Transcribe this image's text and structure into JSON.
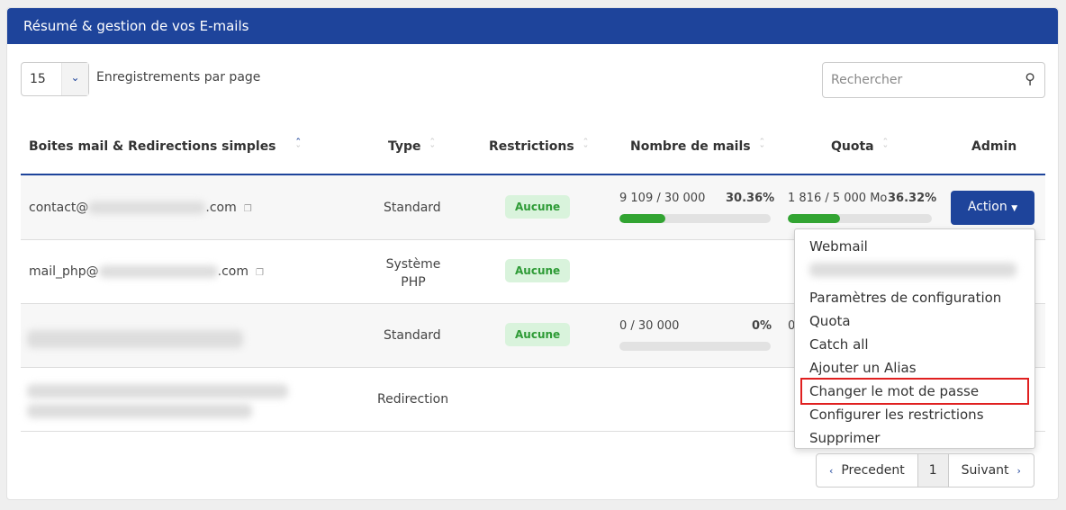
{
  "header": {
    "title": "Résumé & gestion de vos E-mails"
  },
  "controls": {
    "per_page_value": "15",
    "per_page_label": "Enregistrements par page",
    "search_placeholder": "Rechercher"
  },
  "columns": [
    "Boites mail & Redirections simples",
    "Type",
    "Restrictions",
    "Nombre de mails",
    "Quota",
    "Admin"
  ],
  "rows": [
    {
      "email_prefix": "contact@",
      "email_suffix": ".com",
      "type": "Standard",
      "restriction": "Aucune",
      "mails": "9 109 / 30 000",
      "mails_pct": "30.36%",
      "mails_fill": 30.36,
      "quota": "1 816 / 5 000 Mo",
      "quota_pct": "36.32%",
      "quota_fill": 36.32,
      "action": "Action"
    },
    {
      "email_prefix": "mail_php@",
      "email_suffix": ".com",
      "type": "Système PHP",
      "restriction": "Aucune"
    },
    {
      "type": "Standard",
      "restriction": "Aucune",
      "mails": "0 / 30 000",
      "mails_pct": "0%",
      "mails_fill": 0,
      "quota": "0"
    },
    {
      "type": "Redirection"
    }
  ],
  "menu": [
    "Webmail",
    "Paramètres de configuration",
    "Quota",
    "Catch all",
    "Ajouter un Alias",
    "Changer le mot de passe",
    "Configurer les restrictions",
    "Supprimer"
  ],
  "pagination": {
    "prev": "Precedent",
    "page": "1",
    "next": "Suivant"
  },
  "colors": {
    "brand": "#1e449b",
    "success": "#32a432",
    "highlight": "#e02020"
  }
}
